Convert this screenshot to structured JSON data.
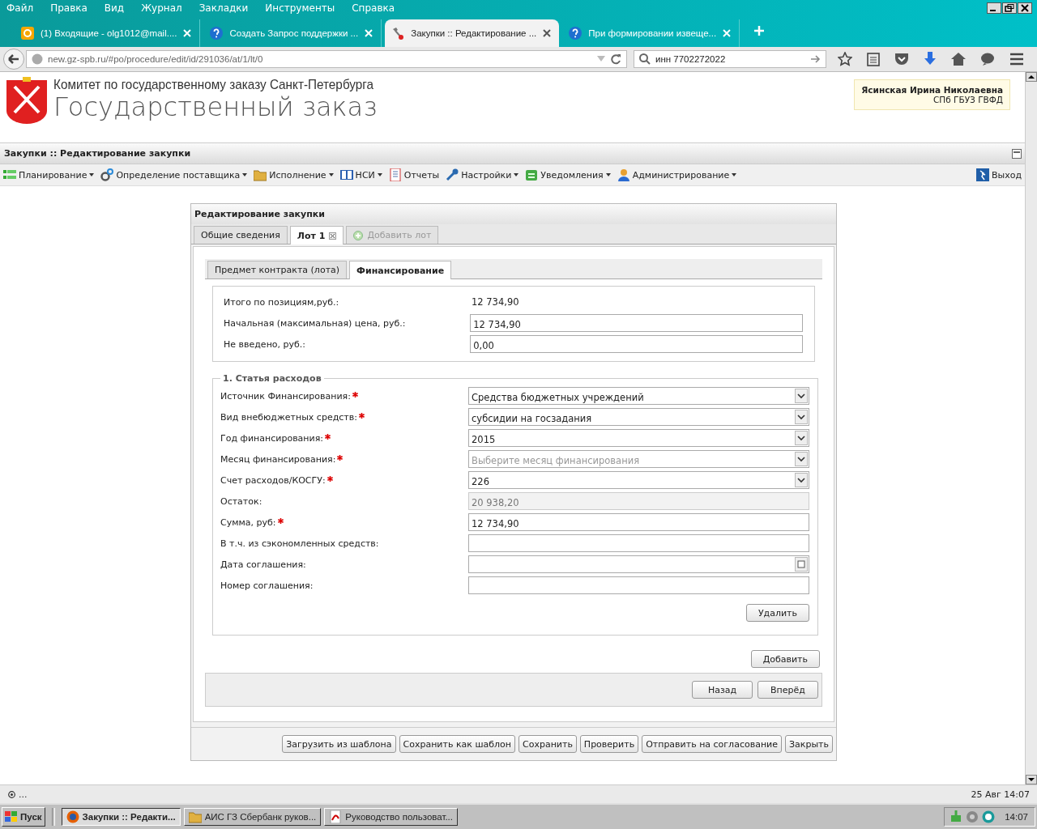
{
  "browser": {
    "menu": [
      "Файл",
      "Правка",
      "Вид",
      "Журнал",
      "Закладки",
      "Инструменты",
      "Справка"
    ],
    "tabs": [
      {
        "title": "(1) Входящие - olg1012@mail....",
        "selected": false
      },
      {
        "title": "Создать Запрос поддержки ...",
        "selected": false
      },
      {
        "title": "Закупки :: Редактирование ...",
        "selected": true
      },
      {
        "title": "При формировании извеще...",
        "selected": false
      }
    ],
    "url": "new.gz-spb.ru/#po/procedure/edit/id/291036/at/1/lt/0",
    "search": "инн 7702272022"
  },
  "header": {
    "org": "Комитет по государственному заказу Санкт-Петербурга",
    "title": "Государственный заказ",
    "user_name": "Ясинская Ирина Николаевна",
    "user_org": "СПб ГБУЗ ГВФД"
  },
  "app": {
    "title": "Закупки :: Редактирование закупки",
    "toolbar": [
      {
        "label": "Планирование",
        "dropdown": true
      },
      {
        "label": "Определение поставщика",
        "dropdown": true
      },
      {
        "label": "Исполнение",
        "dropdown": true
      },
      {
        "label": "НСИ",
        "dropdown": true
      },
      {
        "label": "Отчеты",
        "dropdown": false
      },
      {
        "label": "Настройки",
        "dropdown": true
      },
      {
        "label": "Уведомления",
        "dropdown": true
      },
      {
        "label": "Администрирование",
        "dropdown": true
      }
    ],
    "logout": "Выход"
  },
  "dialog": {
    "title": "Редактирование закупки",
    "tabs": [
      {
        "label": "Общие сведения",
        "selected": false,
        "closable": false,
        "disabled": false
      },
      {
        "label": "Лот 1",
        "selected": true,
        "closable": true,
        "disabled": false
      },
      {
        "label": "Добавить лот",
        "selected": false,
        "closable": false,
        "disabled": true
      }
    ],
    "subtabs": [
      {
        "label": "Предмет контракта (лота)",
        "selected": false
      },
      {
        "label": "Финансирование",
        "selected": true
      }
    ],
    "summary": [
      {
        "label": "Итого по позициям,руб.:",
        "kind": "text",
        "value": "12 734,90"
      },
      {
        "label": "Начальная (максимальная) цена, руб.:",
        "kind": "input",
        "value": "12 734,90"
      },
      {
        "label": "Не введено, руб.:",
        "kind": "input",
        "value": "0,00"
      }
    ],
    "section": "1. Статья расходов",
    "fields": [
      {
        "label": "Источник Финансирования:",
        "required": true,
        "disabled": false,
        "kind": "select",
        "value": "Средства бюджетных учреждений"
      },
      {
        "label": "Вид внебюджетных средств:",
        "required": true,
        "disabled": false,
        "kind": "select",
        "value": "субсидии на госзадания"
      },
      {
        "label": "Год финансирования:",
        "required": true,
        "disabled": false,
        "kind": "select",
        "value": "2015"
      },
      {
        "label": "Месяц финансирования:",
        "required": true,
        "disabled": false,
        "kind": "select",
        "placeholder": "Выберите месяц финансирования"
      },
      {
        "label": "Счет расходов/КОСГУ:",
        "required": true,
        "disabled": false,
        "kind": "select",
        "value": "226"
      },
      {
        "label": "Остаток:",
        "required": false,
        "disabled": true,
        "kind": "input",
        "value": "20 938,20"
      },
      {
        "label": "Сумма, руб:",
        "required": true,
        "disabled": false,
        "kind": "input",
        "value": "12 734,90"
      },
      {
        "label": "В т.ч. из сэкономленных средств:",
        "required": false,
        "disabled": false,
        "kind": "input"
      },
      {
        "label": "Дата соглашения:",
        "required": false,
        "disabled": false,
        "kind": "date"
      },
      {
        "label": "Номер соглашения:",
        "required": false,
        "disabled": false,
        "kind": "input"
      }
    ],
    "delete_button": "Удалить",
    "add_button": "Добавить",
    "nav_buttons": [
      "Назад",
      "Вперёд"
    ],
    "footer_buttons": [
      "Загрузить из шаблона",
      "Сохранить как шаблон",
      "Сохранить",
      "Проверить",
      "Отправить на согласование",
      "Закрыть"
    ]
  },
  "status_bar": {
    "left": "...",
    "right": "25 Авг 14:07"
  },
  "taskbar": {
    "start": "Пуск",
    "items": [
      {
        "label": "Закупки :: Редакти...",
        "selected": true
      },
      {
        "label": "АИС ГЗ Сбербанк руков...",
        "selected": false
      },
      {
        "label": "Руководство пользоват...",
        "selected": false
      }
    ],
    "clock": "14:07"
  }
}
